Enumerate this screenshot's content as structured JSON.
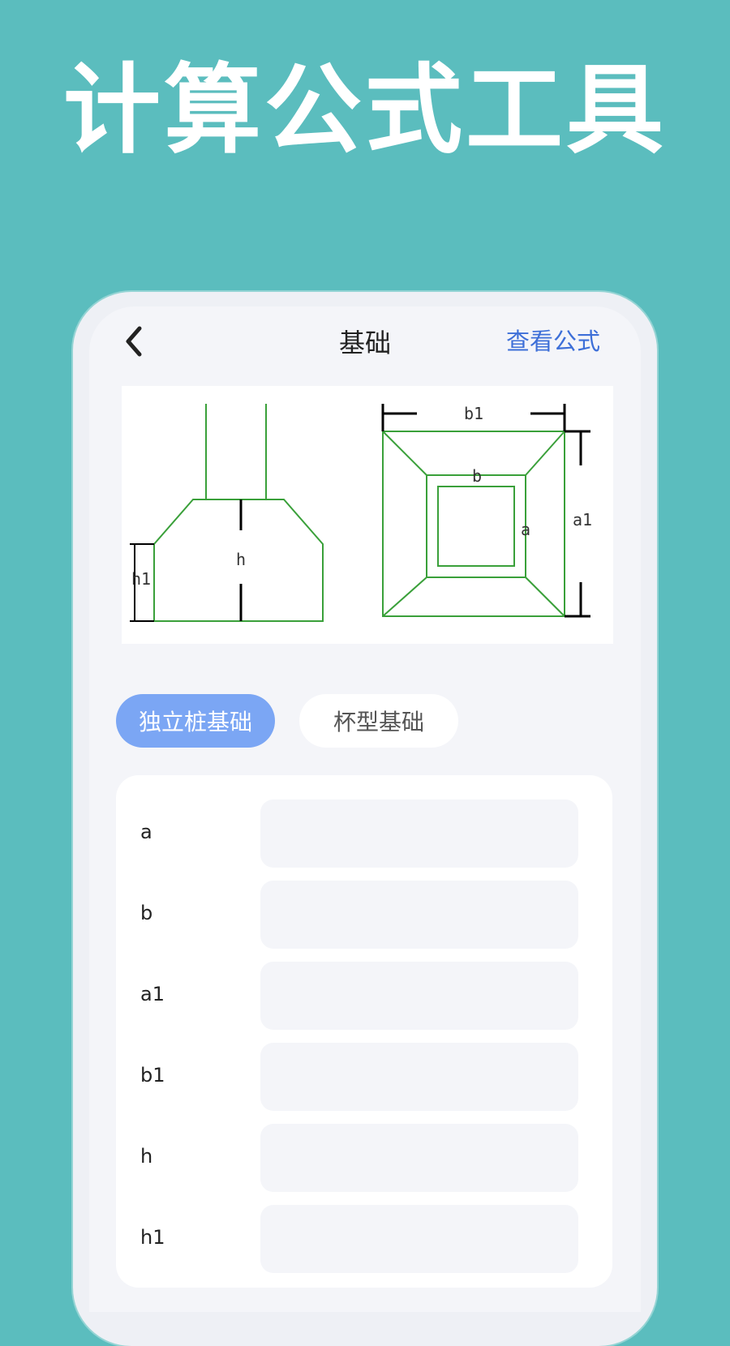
{
  "promo": {
    "title": "计算公式工具"
  },
  "nav": {
    "back_icon": "chevron-left-icon",
    "title": "基础",
    "view_formula": "查看公式"
  },
  "diagram": {
    "side_view": {
      "h_label": "h",
      "h1_label": "h1"
    },
    "top_view": {
      "b1_label": "b1",
      "b_label": "b",
      "a_label": "a",
      "a1_label": "a1"
    },
    "line_color": "#3aa03a"
  },
  "tabs": [
    {
      "label": "独立桩基础",
      "active": true
    },
    {
      "label": "杯型基础",
      "active": false
    }
  ],
  "fields": [
    {
      "label": "a",
      "value": ""
    },
    {
      "label": "b",
      "value": ""
    },
    {
      "label": "a1",
      "value": ""
    },
    {
      "label": "b1",
      "value": ""
    },
    {
      "label": "h",
      "value": ""
    },
    {
      "label": "h1",
      "value": ""
    }
  ],
  "colors": {
    "background": "#5bbdbe",
    "accent": "#3d6fd8",
    "tab_active": "#7ba6f4"
  }
}
